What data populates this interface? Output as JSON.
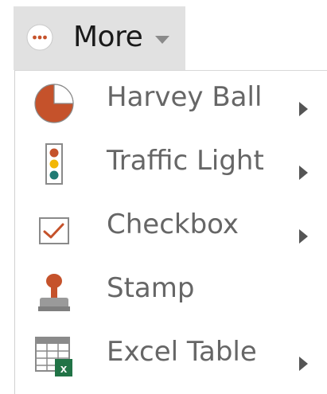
{
  "more_button": {
    "label": "More",
    "icon": "more-dots-icon",
    "caret_icon": "caret-down-icon"
  },
  "menu": {
    "items": [
      {
        "label": "Harvey Ball",
        "icon": "harvey-ball-icon",
        "has_submenu": true
      },
      {
        "label": "Traffic Light",
        "icon": "traffic-light-icon",
        "has_submenu": true
      },
      {
        "label": "Checkbox",
        "icon": "checkbox-icon",
        "has_submenu": true
      },
      {
        "label": "Stamp",
        "icon": "stamp-icon",
        "has_submenu": false
      },
      {
        "label": "Excel Table",
        "icon": "excel-table-icon",
        "has_submenu": true
      }
    ]
  },
  "colors": {
    "accent": "#c5522b",
    "button_bg": "#e1e1e1",
    "label_text": "#666666",
    "traffic_red": "#c5522b",
    "traffic_yellow": "#f2b705",
    "traffic_green": "#1f7a73",
    "excel_green": "#217346"
  }
}
